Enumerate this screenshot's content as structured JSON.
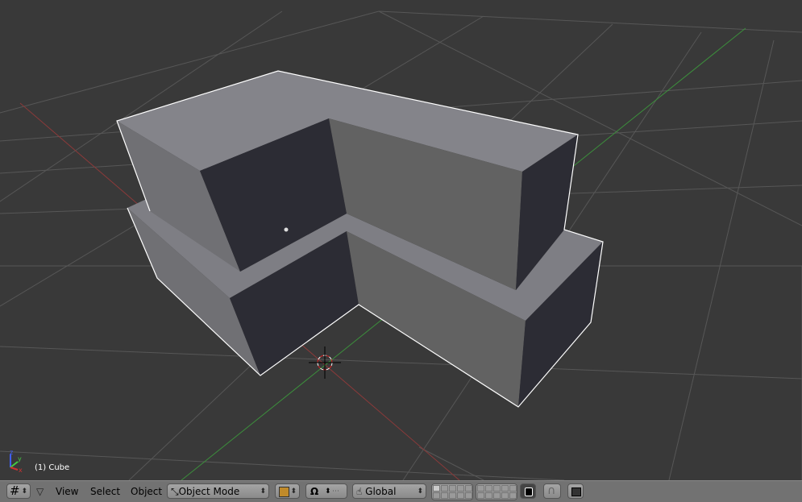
{
  "viewport": {
    "object_label": "(1) Cube",
    "axis_labels": {
      "x": "x",
      "y": "y",
      "z": "z"
    },
    "colors": {
      "background": "#393939",
      "grid": "#555555",
      "x_axis": "#8a3a3a",
      "y_axis": "#3c8f3c",
      "selection_outline": "#ffffff"
    }
  },
  "header": {
    "editor_type_icon": "grid-icon",
    "menus": [
      "View",
      "Select",
      "Object"
    ],
    "mode": "Object Mode",
    "pivot_icon": "pivot-icon",
    "transform_orientation": "Global",
    "lock_icon": "lock-icon",
    "snap_icon": "magnet-icon",
    "render_icon": "image-icon"
  }
}
